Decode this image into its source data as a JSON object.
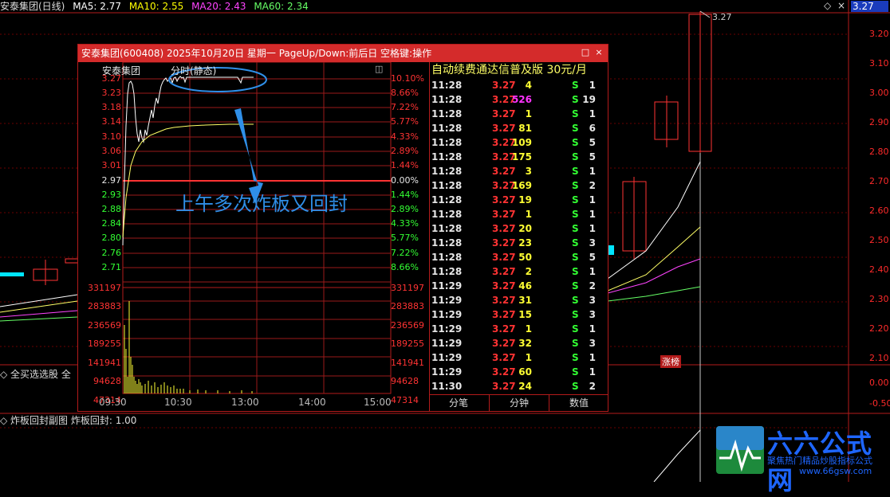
{
  "header": {
    "stock_name": "安泰集团(日线)",
    "ma5": "MA5: 2.77",
    "ma10": "MA10: 2.55",
    "ma20": "MA20: 2.43",
    "ma60": "MA60: 2.34",
    "price_flag": "3.27"
  },
  "right_axis": [
    "3.20",
    "3.10",
    "3.00",
    "2.90",
    "2.80",
    "2.70",
    "2.60",
    "2.50",
    "2.40",
    "2.30",
    "2.20",
    "2.10",
    "0.00",
    "-0.50"
  ],
  "peak_label": "3.27",
  "zhangting_badge": "涨榜",
  "panel": {
    "title": "安泰集团(600408)  2025年10月20日  星期一  PageUp/Down:前后日  空格键:操作",
    "stock_label": "安泰集团",
    "mode_label": "分时(静态)",
    "price_ticks": [
      "3.27",
      "3.23",
      "3.18",
      "3.14",
      "3.10",
      "3.06",
      "3.01",
      "2.97",
      "2.93",
      "2.88",
      "2.84",
      "2.80",
      "2.76",
      "2.71"
    ],
    "pct_ticks": [
      "10.10%",
      "8.66%",
      "7.22%",
      "5.77%",
      "4.33%",
      "2.89%",
      "1.44%",
      "0.00%",
      "1.44%",
      "2.89%",
      "4.33%",
      "5.77%",
      "7.22%",
      "8.66%"
    ],
    "volume_ticks": [
      "331197",
      "283883",
      "236569",
      "189255",
      "141941",
      "94628",
      "47314"
    ],
    "time_ticks": [
      "09:30",
      "10:30",
      "13:00",
      "14:00",
      "15:00"
    ],
    "annotation": "上午多次炸板又回封"
  },
  "ticks": {
    "header": "自动续费通达信普及版   30元/月",
    "rows": [
      {
        "time": "11:28",
        "price": "3.27",
        "vol": "4",
        "side": "S",
        "n": "1",
        "vol_color": "yellow"
      },
      {
        "time": "11:28",
        "price": "3.27",
        "vol": "526",
        "side": "S",
        "n": "19",
        "vol_color": "magenta"
      },
      {
        "time": "11:28",
        "price": "3.27",
        "vol": "1",
        "side": "S",
        "n": "1",
        "vol_color": "yellow"
      },
      {
        "time": "11:28",
        "price": "3.27",
        "vol": "81",
        "side": "S",
        "n": "6",
        "vol_color": "yellow"
      },
      {
        "time": "11:28",
        "price": "3.27",
        "vol": "109",
        "side": "S",
        "n": "5",
        "vol_color": "yellow"
      },
      {
        "time": "11:28",
        "price": "3.27",
        "vol": "175",
        "side": "S",
        "n": "5",
        "vol_color": "yellow"
      },
      {
        "time": "11:28",
        "price": "3.27",
        "vol": "3",
        "side": "S",
        "n": "1",
        "vol_color": "yellow"
      },
      {
        "time": "11:28",
        "price": "3.27",
        "vol": "169",
        "side": "S",
        "n": "2",
        "vol_color": "yellow"
      },
      {
        "time": "11:28",
        "price": "3.27",
        "vol": "19",
        "side": "S",
        "n": "1",
        "vol_color": "yellow"
      },
      {
        "time": "11:28",
        "price": "3.27",
        "vol": "1",
        "side": "S",
        "n": "1",
        "vol_color": "yellow"
      },
      {
        "time": "11:28",
        "price": "3.27",
        "vol": "20",
        "side": "S",
        "n": "1",
        "vol_color": "yellow"
      },
      {
        "time": "11:28",
        "price": "3.27",
        "vol": "23",
        "side": "S",
        "n": "3",
        "vol_color": "yellow"
      },
      {
        "time": "11:28",
        "price": "3.27",
        "vol": "50",
        "side": "S",
        "n": "5",
        "vol_color": "yellow"
      },
      {
        "time": "11:28",
        "price": "3.27",
        "vol": "2",
        "side": "S",
        "n": "1",
        "vol_color": "yellow"
      },
      {
        "time": "11:29",
        "price": "3.27",
        "vol": "46",
        "side": "S",
        "n": "2",
        "vol_color": "yellow"
      },
      {
        "time": "11:29",
        "price": "3.27",
        "vol": "31",
        "side": "S",
        "n": "3",
        "vol_color": "yellow"
      },
      {
        "time": "11:29",
        "price": "3.27",
        "vol": "15",
        "side": "S",
        "n": "3",
        "vol_color": "yellow"
      },
      {
        "time": "11:29",
        "price": "3.27",
        "vol": "1",
        "side": "S",
        "n": "1",
        "vol_color": "yellow"
      },
      {
        "time": "11:29",
        "price": "3.27",
        "vol": "32",
        "side": "S",
        "n": "3",
        "vol_color": "yellow"
      },
      {
        "time": "11:29",
        "price": "3.27",
        "vol": "1",
        "side": "S",
        "n": "1",
        "vol_color": "yellow"
      },
      {
        "time": "11:29",
        "price": "3.27",
        "vol": "60",
        "side": "S",
        "n": "1",
        "vol_color": "yellow"
      },
      {
        "time": "11:30",
        "price": "3.27",
        "vol": "24",
        "side": "S",
        "n": "2",
        "vol_color": "yellow"
      }
    ],
    "tabs": [
      "分笔",
      "分钟",
      "数值"
    ]
  },
  "left_bar": "全买选选股  全",
  "bottom_bar": "炸板回封副图  炸板回封: 1.00",
  "watermark": {
    "brand": "六六公式网",
    "url": "www.66gsw.com",
    "tagline": "聚焦热门精品炒股指标公式"
  }
}
